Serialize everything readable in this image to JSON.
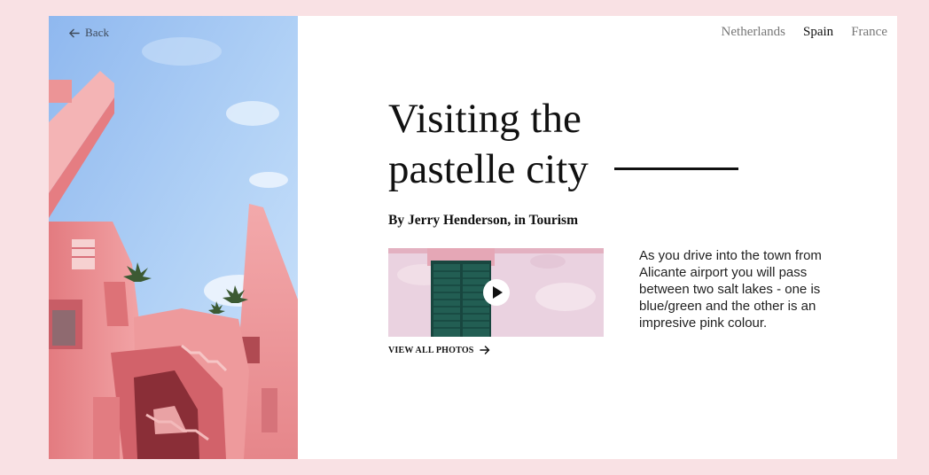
{
  "header": {
    "back_label": "Back",
    "back_icon": "arrow-left-icon"
  },
  "nav": {
    "items": [
      {
        "label": "Netherlands",
        "active": false
      },
      {
        "label": "Spain",
        "active": true
      },
      {
        "label": "France",
        "active": false
      }
    ]
  },
  "article": {
    "title_line1": "Visiting the",
    "title_line2": "pastelle city",
    "byline": "By Jerry Henderson, in Tourism",
    "description": "As you drive into the town from Alicante airport you will pass between two salt lakes - one is blue/green and the other is an impresive pink colour."
  },
  "media": {
    "play_icon": "play-icon",
    "view_all_label": "VIEW ALL PHOTOS",
    "view_all_icon": "arrow-right-icon"
  },
  "colors": {
    "page_background": "#f9e1e4",
    "card_background": "#ffffff",
    "accent_pink": "#e8868a",
    "sky_blue": "#a9cdf5",
    "shutter_green": "#1e5a50",
    "text_primary": "#111111",
    "nav_inactive": "#777777"
  }
}
